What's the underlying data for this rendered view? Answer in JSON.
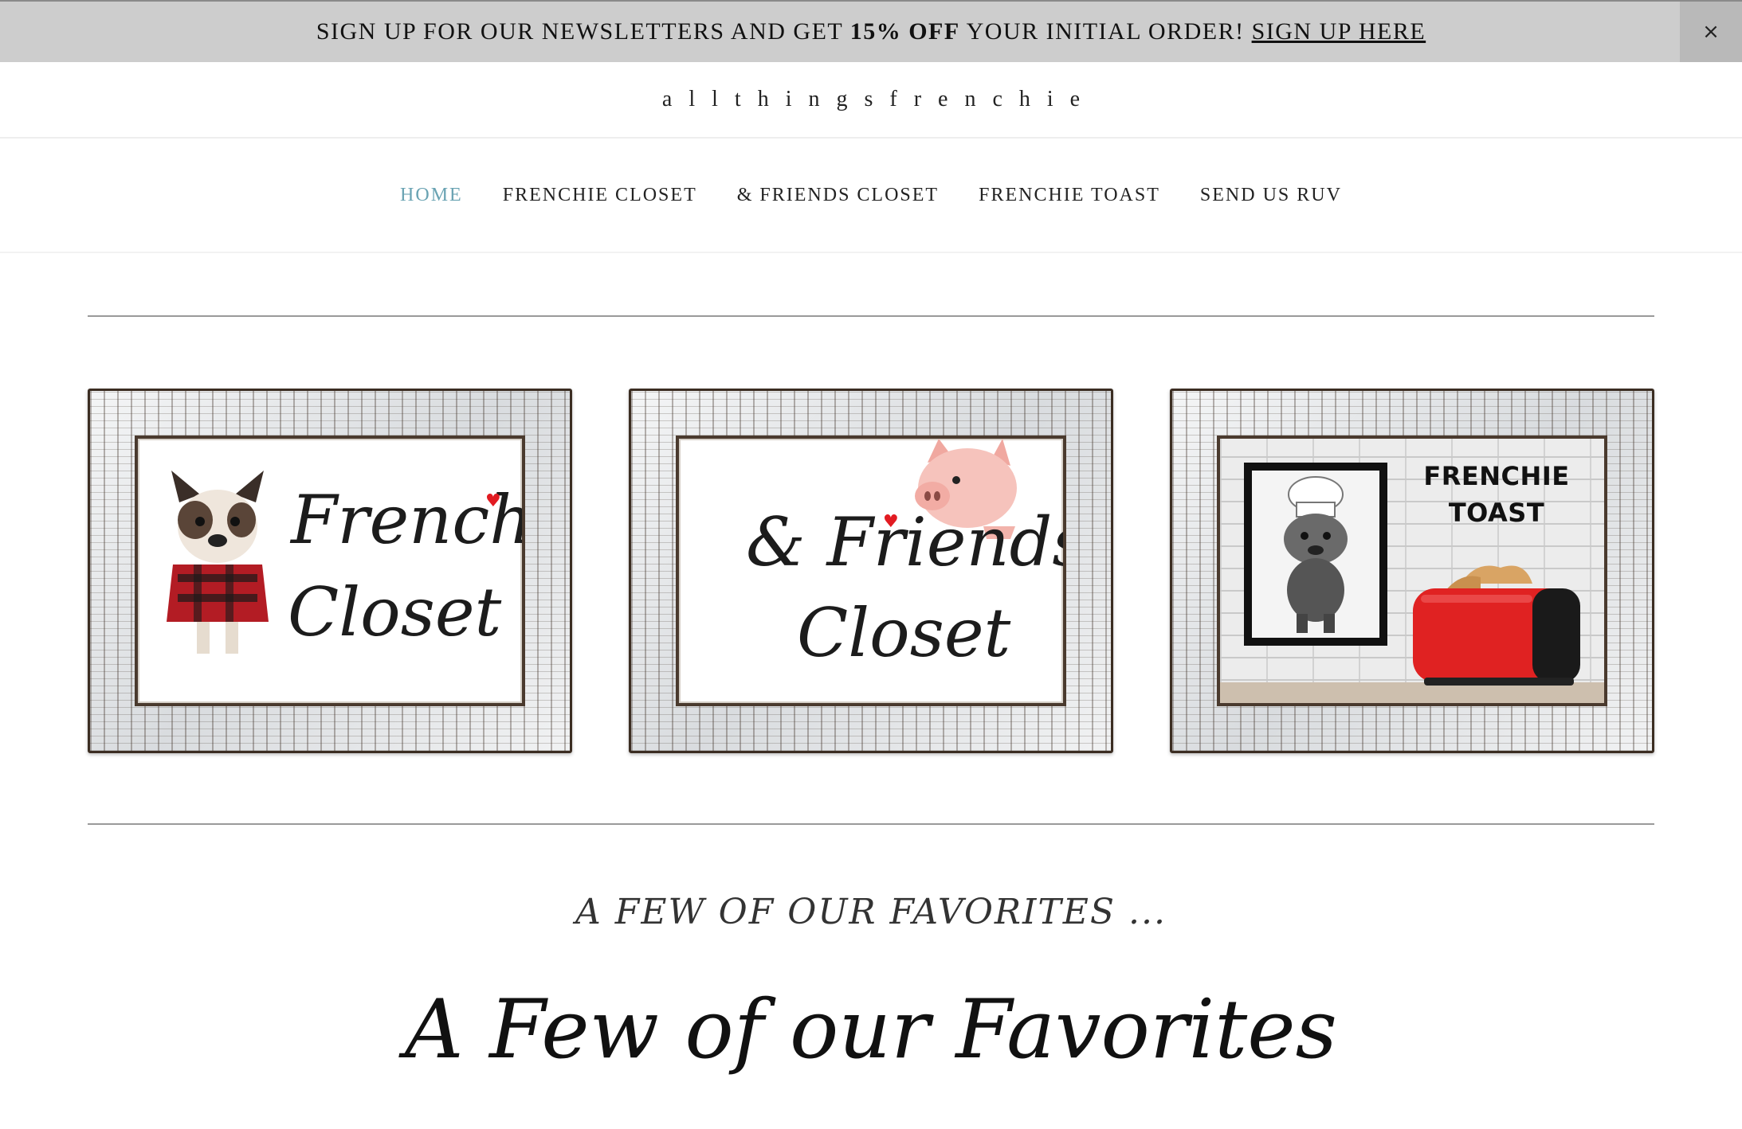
{
  "announcement": {
    "text_before": "SIGN UP FOR OUR NEWSLETTERS AND GET ",
    "discount": "15% OFF",
    "text_after": " YOUR INITIAL ORDER! ",
    "link": "SIGN UP HERE",
    "close": "×"
  },
  "logo": "allthingsfrenchie",
  "nav": [
    {
      "label": "HOME",
      "active": true
    },
    {
      "label": "FRENCHIE CLOSET",
      "active": false
    },
    {
      "label": "& FRIENDS CLOSET",
      "active": false
    },
    {
      "label": "FRENCHIE TOAST",
      "active": false
    },
    {
      "label": "SEND US RUV",
      "active": false
    }
  ],
  "tiles": {
    "frenchie": {
      "line1": "Frenchie",
      "line2": "Closet"
    },
    "friends": {
      "line1": "& Friends",
      "line2": "Closet"
    },
    "toast": {
      "line1": "FRENCHIE",
      "line2": "TOAST"
    }
  },
  "favorites_subheading": "A FEW OF OUR FAVORITES ...",
  "favorites_heading": "A Few of our Favorites",
  "colors": {
    "nav_active": "#6aa3b3",
    "announcement_bg": "#cdcdcd",
    "heart": "#e21b22",
    "toaster": "#e02222"
  }
}
